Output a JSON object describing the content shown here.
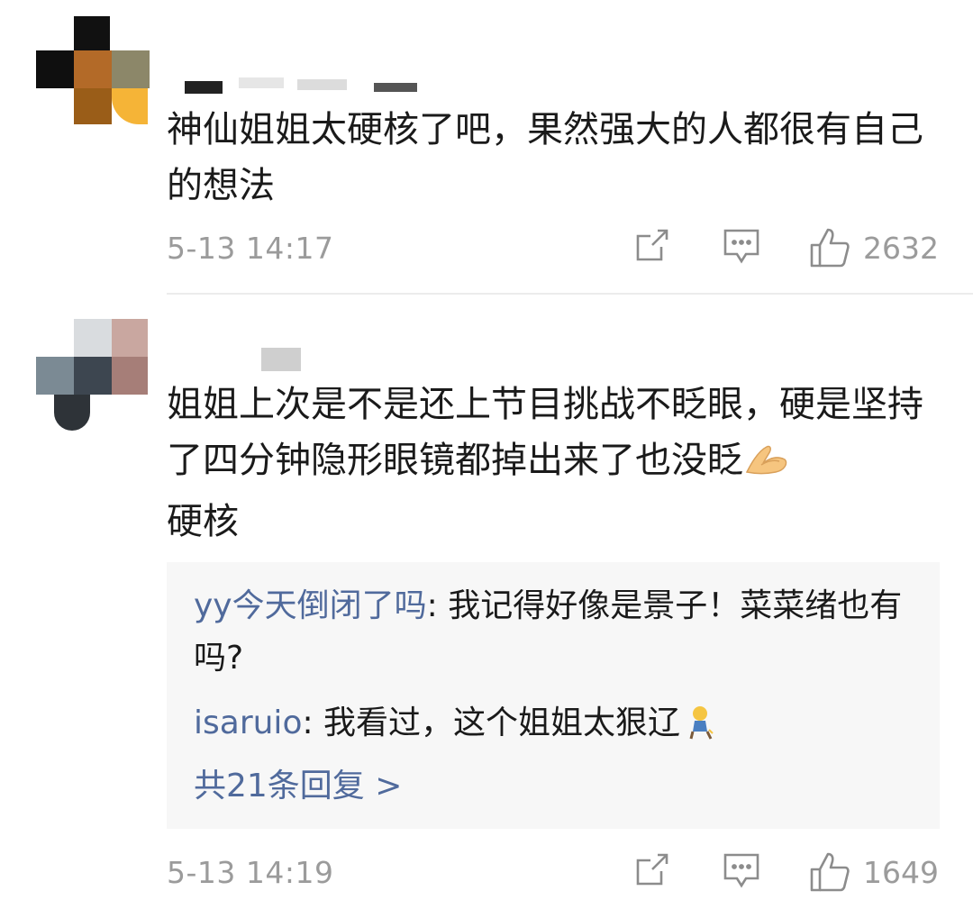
{
  "comments": [
    {
      "text": "神仙姐姐太硬核了吧，果然强大的人都很有自己的想法",
      "timestamp": "5-13 14:17",
      "like_count": "2632"
    },
    {
      "text": "姐姐上次是不是还上节目挑战不眨眼，硬是坚持了四分钟隐形眼镜都掉出来了也没眨",
      "text_tail": "硬核",
      "timestamp": "5-13 14:19",
      "like_count": "1649",
      "replies": [
        {
          "user": "yy今天倒闭了吗",
          "separator": ": ",
          "text": "我记得好像是景子！菜菜绪也有吗?"
        },
        {
          "user": "isaruio",
          "separator": ": ",
          "text": "我看过，这个姐姐太狠辽"
        }
      ],
      "more_replies": "共21条回复 >"
    }
  ],
  "icons": {
    "share": "share-icon",
    "comment": "comment-icon",
    "like": "thumbs-up-icon",
    "emoji_clasp": "folded-hands-emoji",
    "emoji_kneel": "kneeling-person-emoji"
  },
  "colors": {
    "text": "#1a1a1a",
    "meta": "#9b9b9b",
    "link": "#506a9c",
    "reply_bg": "#f7f7f7",
    "divider": "#ececec"
  }
}
